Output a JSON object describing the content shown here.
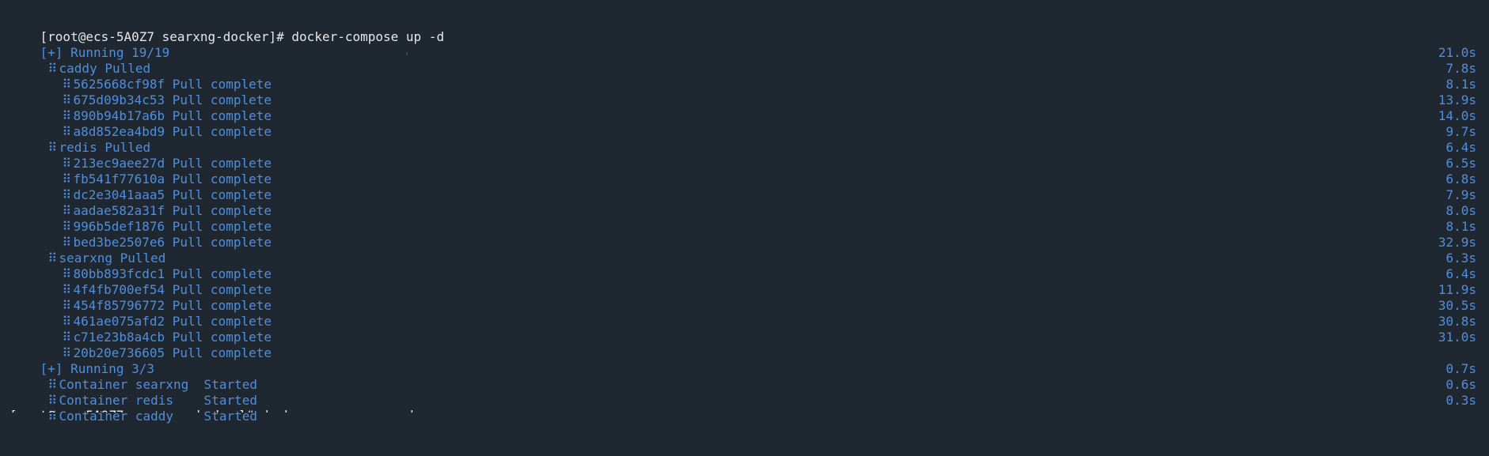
{
  "prompt": {
    "text": "[root@ecs-5A0Z7 searxng-docker]# docker-compose up -d"
  },
  "running_pull": {
    "label": "[+] Running 19/19"
  },
  "pulled_groups": [
    {
      "name": "caddy Pulled",
      "time": "21.0s",
      "layers": [
        {
          "id": "5625668cf98f",
          "status": "Pull complete",
          "time": "7.8s"
        },
        {
          "id": "675d09b34c53",
          "status": "Pull complete",
          "time": "8.1s"
        },
        {
          "id": "890b94b17a6b",
          "status": "Pull complete",
          "time": "13.9s"
        },
        {
          "id": "a8d852ea4bd9",
          "status": "Pull complete",
          "time": "14.0s"
        }
      ]
    },
    {
      "name": "redis Pulled",
      "time": "9.7s",
      "layers": [
        {
          "id": "213ec9aee27d",
          "status": "Pull complete",
          "time": "6.4s"
        },
        {
          "id": "fb541f77610a",
          "status": "Pull complete",
          "time": "6.5s"
        },
        {
          "id": "dc2e3041aaa5",
          "status": "Pull complete",
          "time": "6.8s"
        },
        {
          "id": "aadae582a31f",
          "status": "Pull complete",
          "time": "7.9s"
        },
        {
          "id": "996b5def1876",
          "status": "Pull complete",
          "time": "8.0s"
        },
        {
          "id": "bed3be2507e6",
          "status": "Pull complete",
          "time": "8.1s"
        }
      ]
    },
    {
      "name": "searxng Pulled",
      "time": "32.9s",
      "layers": [
        {
          "id": "80bb893fcdc1",
          "status": "Pull complete",
          "time": "6.3s"
        },
        {
          "id": "4f4fb700ef54",
          "status": "Pull complete",
          "time": "6.4s"
        },
        {
          "id": "454f85796772",
          "status": "Pull complete",
          "time": "11.9s"
        },
        {
          "id": "461ae075afd2",
          "status": "Pull complete",
          "time": "30.5s"
        },
        {
          "id": "c71e23b8a4cb",
          "status": "Pull complete",
          "time": "30.8s"
        },
        {
          "id": "20b20e736605",
          "status": "Pull complete",
          "time": "31.0s"
        }
      ]
    }
  ],
  "running_containers": {
    "label": "[+] Running 3/3"
  },
  "containers": [
    {
      "text": "Container searxng  Started",
      "time": "0.7s"
    },
    {
      "text": "Container redis    Started",
      "time": "0.6s"
    },
    {
      "text": "Container caddy    Started",
      "time": "0.3s"
    }
  ],
  "icons": {
    "drag_handle": "⠿"
  },
  "colors": {
    "background": "#1f2731",
    "prompt_text": "#e4e8ec",
    "status_text": "#4f8fdf"
  }
}
